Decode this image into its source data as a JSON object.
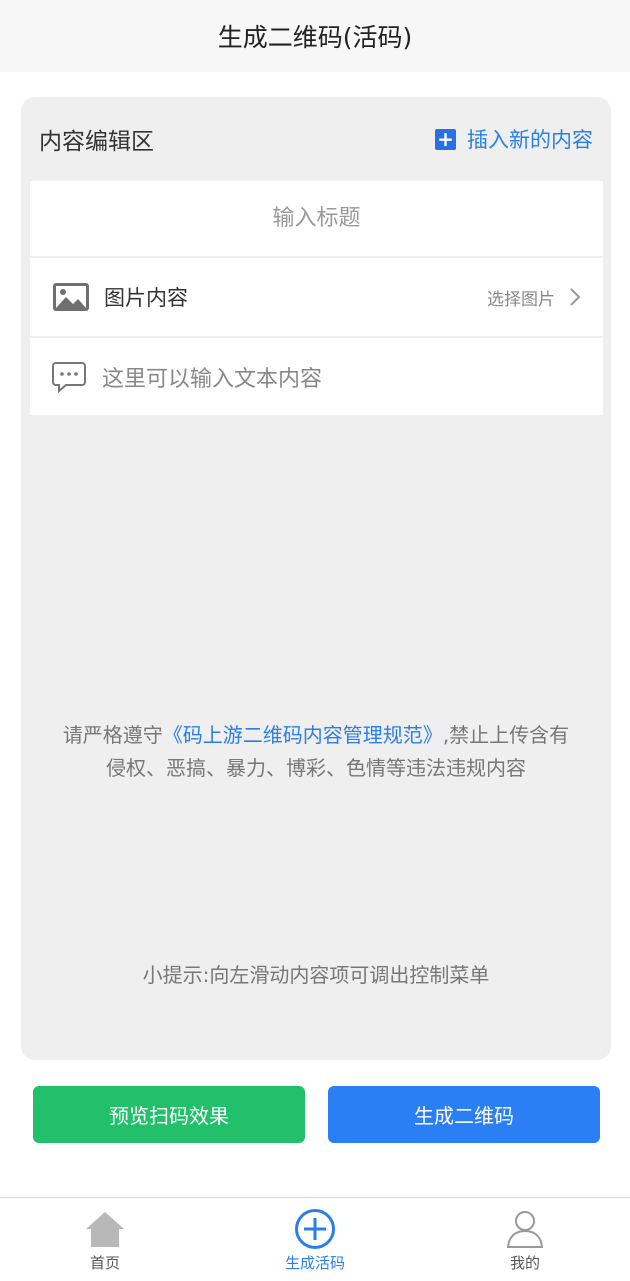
{
  "header": {
    "title": "生成二维码(活码)"
  },
  "editor": {
    "label": "内容编辑区",
    "insert_label": "插入新的内容",
    "title_placeholder": "输入标题",
    "image_row": {
      "label": "图片内容",
      "action": "选择图片"
    },
    "text_row": {
      "placeholder": "这里可以输入文本内容"
    }
  },
  "notice": {
    "prefix": "请严格遵守",
    "link": "《码上游二维码内容管理规范》",
    "suffix": ",禁止上传含有侵权、恶搞、暴力、博彩、色情等违法违规内容"
  },
  "tip": "小提示:向左滑动内容项可调出控制菜单",
  "buttons": {
    "preview": "预览扫码效果",
    "generate": "生成二维码"
  },
  "tabbar": {
    "items": [
      {
        "label": "首页",
        "icon": "home-icon"
      },
      {
        "label": "生成活码",
        "icon": "plus-circle-icon",
        "active": true
      },
      {
        "label": "我的",
        "icon": "user-icon"
      }
    ]
  },
  "colors": {
    "accent": "#2a7fe6",
    "preview_button": "#22c06a",
    "generate_button": "#2a7ff5",
    "card_background": "#efefef"
  }
}
